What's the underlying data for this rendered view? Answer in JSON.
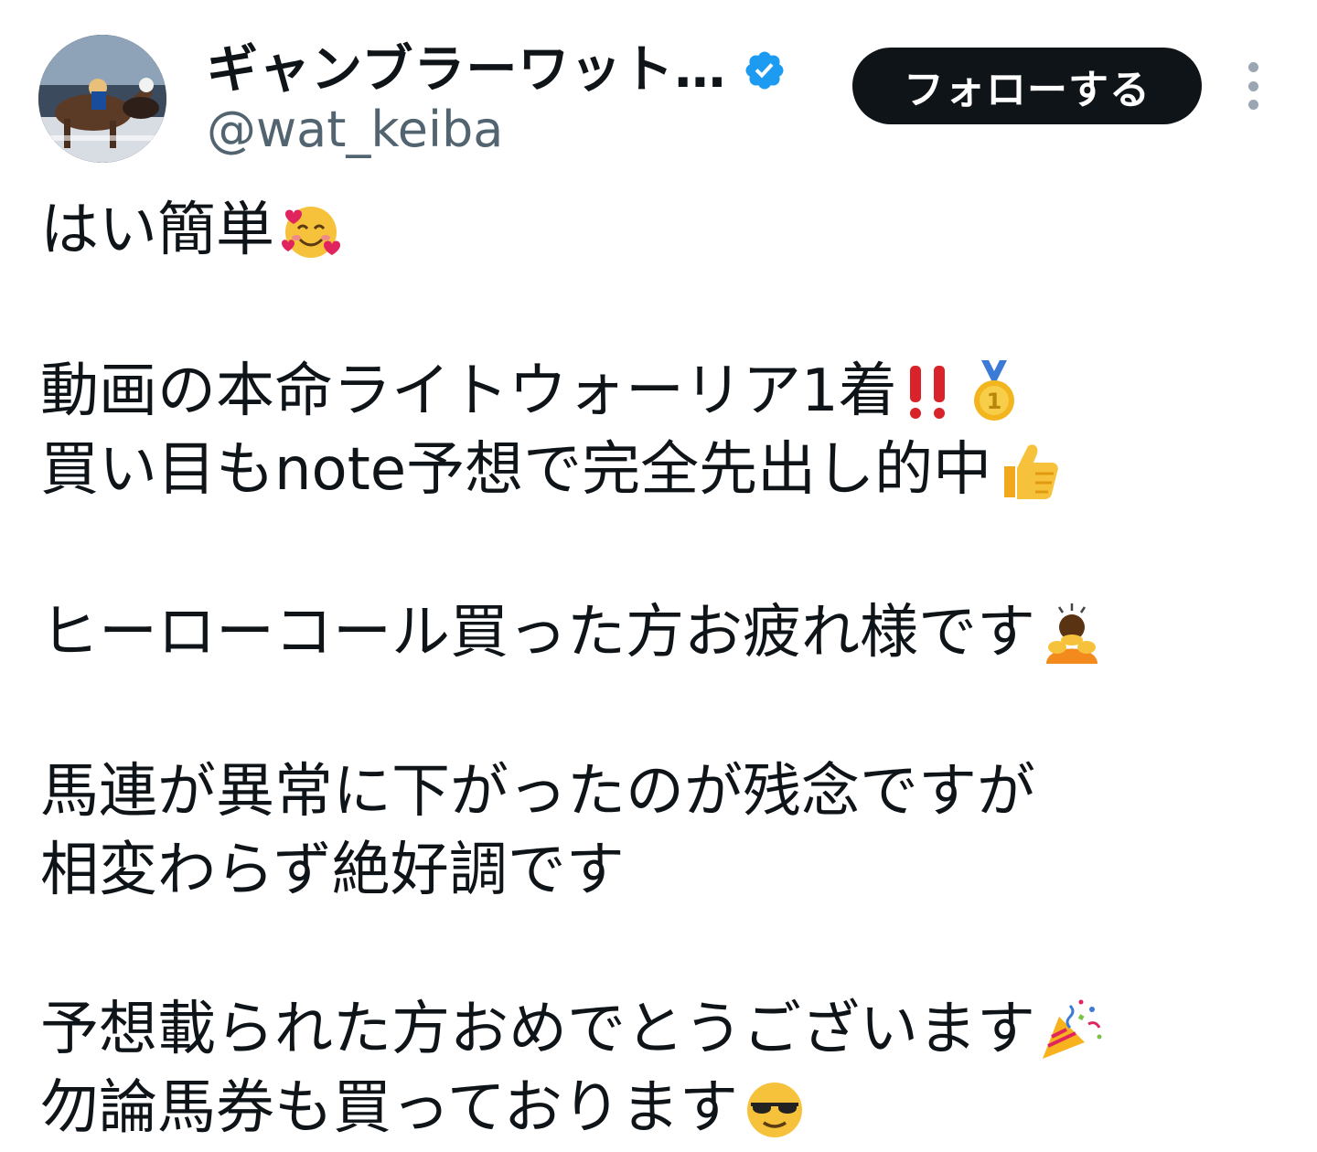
{
  "author": {
    "display_name": "ギャンブラーワット…",
    "handle": "@wat_keiba",
    "verified": true,
    "avatar_icon": "horse-racing-photo-avatar"
  },
  "actions": {
    "follow_label": "フォローする",
    "more_icon": "more-vertical-icon"
  },
  "tweet": {
    "lines": [
      {
        "text": "はい簡単",
        "emoji": "smiling-face-with-hearts-icon"
      },
      {
        "text": "動画の本命ライトウォーリア1着",
        "emoji": "double-exclamation-medal-icon"
      },
      {
        "text": "買い目もnote予想で完全先出し的中",
        "emoji": "thumbs-up-icon"
      },
      {
        "text": "ヒーローコール買った方お疲れ様です",
        "emoji": "person-bowing-icon"
      },
      {
        "text": "馬連が異常に下がったのが残念ですが",
        "emoji": ""
      },
      {
        "text": "相変わらず絶好調です",
        "emoji": ""
      },
      {
        "text": "予想載られた方おめでとうございます",
        "emoji": "party-popper-icon"
      },
      {
        "text": "勿論馬券も買っております",
        "emoji": "sunglasses-face-icon"
      }
    ]
  },
  "colors": {
    "text": "#0f1419",
    "secondary_text": "#536471",
    "verified_badge": "#1d9bf0",
    "follow_button": "#0f1419"
  }
}
